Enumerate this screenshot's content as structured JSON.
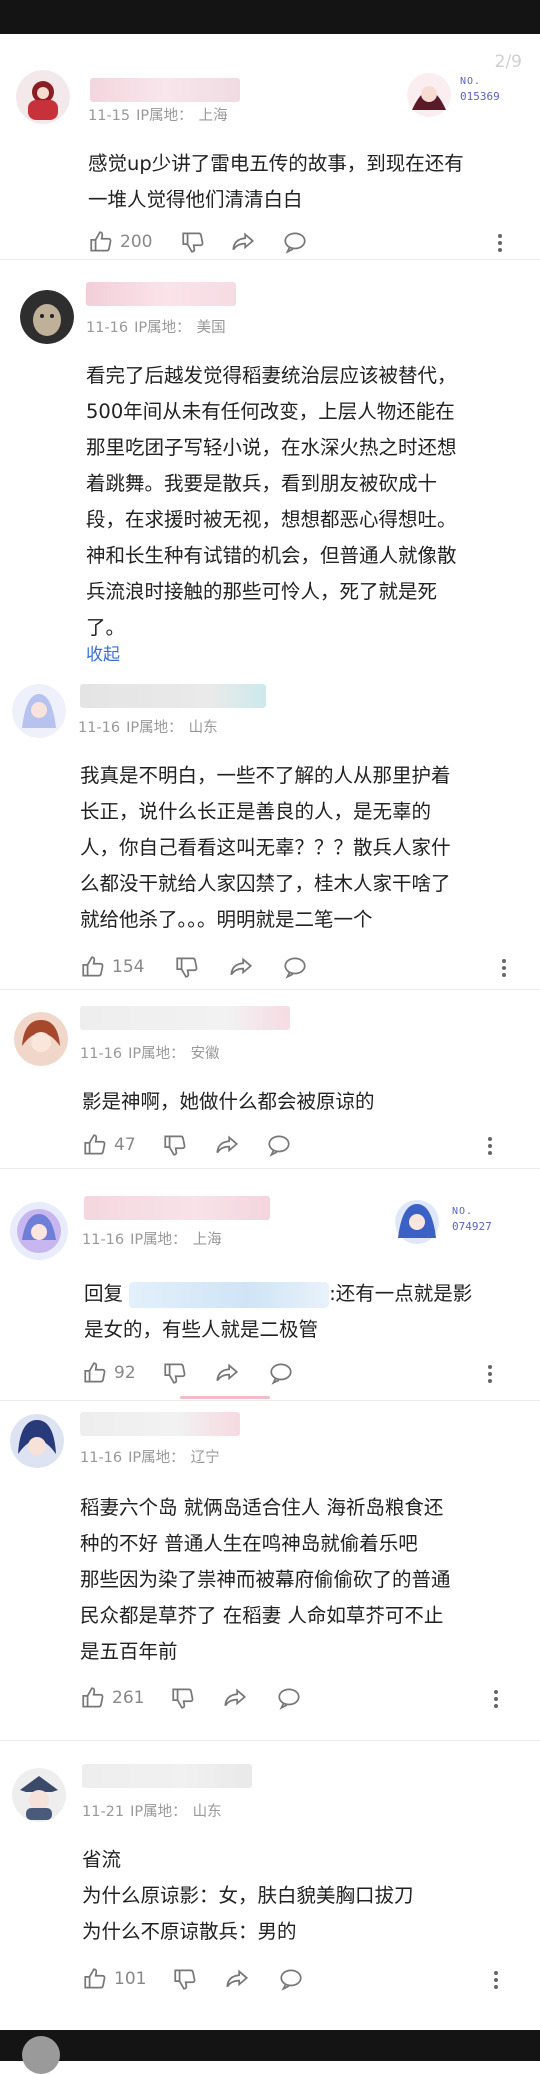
{
  "page_counter": "2/9",
  "comments": [
    {
      "date": "11-15",
      "ip_label": "IP属地：",
      "ip": "上海",
      "badge": {
        "label": "NO.",
        "no": "015369"
      },
      "lines": [
        "感觉up少讲了雷电五传的故事，到现在还有",
        "一堆人觉得他们清清白白"
      ],
      "likes": "200"
    },
    {
      "date": "11-16",
      "ip_label": "IP属地：",
      "ip": "美国",
      "lines": [
        "看完了后越发觉得稻妻统治层应该被替代，",
        "500年间从未有任何改变，上层人物还能在",
        "那里吃团子写轻小说，在水深火热之时还想",
        "着跳舞。我要是散兵，看到朋友被砍成十",
        "段，在求援时被无视，想想都恶心得想吐。",
        "神和长生种有试错的机会，但普通人就像散",
        "兵流浪时接触的那些可怜人，死了就是死",
        "了。"
      ],
      "collapse": "收起"
    },
    {
      "date": "11-16",
      "ip_label": "IP属地：",
      "ip": "山东",
      "lines": [
        "我真是不明白，一些不了解的人从那里护着",
        "长正，说什么长正是善良的人，是无辜的",
        "人，你自己看看这叫无辜？？？散兵人家什",
        "么都没干就给人家囚禁了，桂木人家干啥了",
        "就给他杀了。。。明明就是二笔一个"
      ],
      "likes": "154"
    },
    {
      "date": "11-16",
      "ip_label": "IP属地：",
      "ip": "安徽",
      "lines": [
        "影是神啊，她做什么都会被原谅的"
      ],
      "likes": "47"
    },
    {
      "date": "11-16",
      "ip_label": "IP属地：",
      "ip": "上海",
      "badge": {
        "label": "NO.",
        "no": "074927"
      },
      "reply_prefix": "回复",
      "reply_suffix": ":还有一点就是影",
      "lines": [
        "是女的，有些人就是二极管"
      ],
      "likes": "92"
    },
    {
      "date": "11-16",
      "ip_label": "IP属地：",
      "ip": "辽宁",
      "lines": [
        "稻妻六个岛  就俩岛适合住人  海祈岛粮食还",
        "种的不好   普通人生在鸣神岛就偷着乐吧",
        "那些因为染了祟神而被幕府偷偷砍了的普通",
        "民众都是草芥了    在稻妻 人命如草芥可不止",
        "是五百年前"
      ],
      "likes": "261"
    },
    {
      "date": "11-21",
      "ip_label": "IP属地：",
      "ip": "山东",
      "lines": [
        "省流",
        "为什么原谅影：女，肤白貌美胸口拔刀",
        "为什么不原谅散兵：男的"
      ],
      "likes": "101"
    }
  ],
  "colors": {
    "accent_link": "#3a6fd8",
    "meta_gray": "#999999",
    "text": "#222222"
  }
}
